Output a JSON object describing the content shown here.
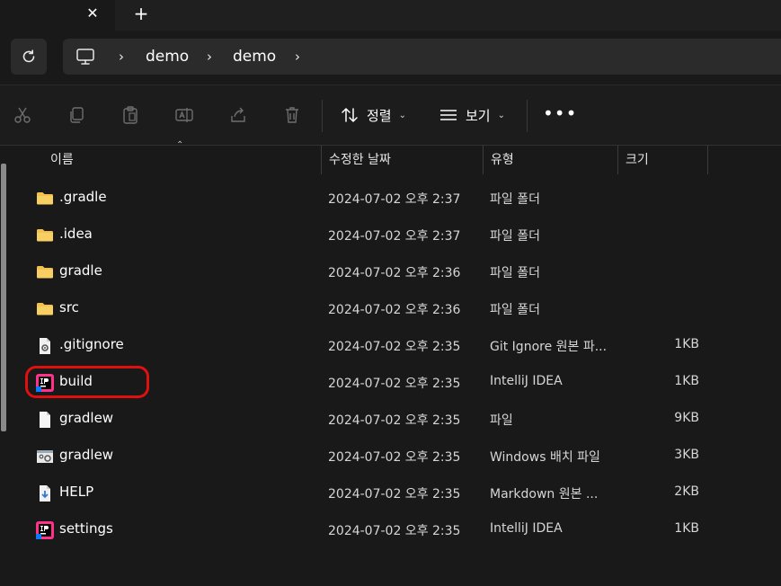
{
  "tabstrip": {
    "close_label": "✕",
    "new_tab_label": "+"
  },
  "address": {
    "crumbs": [
      "demo",
      "demo"
    ],
    "separator": "›"
  },
  "commandbar": {
    "sort_label": "정렬",
    "view_label": "보기",
    "more_label": "•••"
  },
  "columns": {
    "name": "이름",
    "date": "수정한 날짜",
    "type": "유형",
    "size": "크기"
  },
  "files": [
    {
      "name": ".gradle",
      "date": "2024-07-02 오후 2:37",
      "type": "파일 폴더",
      "size": "",
      "icon": "folder-icon"
    },
    {
      "name": ".idea",
      "date": "2024-07-02 오후 2:37",
      "type": "파일 폴더",
      "size": "",
      "icon": "folder-icon"
    },
    {
      "name": "gradle",
      "date": "2024-07-02 오후 2:36",
      "type": "파일 폴더",
      "size": "",
      "icon": "folder-icon"
    },
    {
      "name": "src",
      "date": "2024-07-02 오후 2:36",
      "type": "파일 폴더",
      "size": "",
      "icon": "folder-icon"
    },
    {
      "name": ".gitignore",
      "date": "2024-07-02 오후 2:35",
      "type": "Git Ignore 원본 파...",
      "size": "1KB",
      "icon": "settings-file-icon"
    },
    {
      "name": "build",
      "date": "2024-07-02 오후 2:35",
      "type": "IntelliJ IDEA",
      "size": "1KB",
      "icon": "intellij-icon"
    },
    {
      "name": "gradlew",
      "date": "2024-07-02 오후 2:35",
      "type": "파일",
      "size": "9KB",
      "icon": "file-icon"
    },
    {
      "name": "gradlew",
      "date": "2024-07-02 오후 2:35",
      "type": "Windows 배치 파일",
      "size": "3KB",
      "icon": "batch-file-icon"
    },
    {
      "name": "HELP",
      "date": "2024-07-02 오후 2:35",
      "type": "Markdown 원본 ...",
      "size": "2KB",
      "icon": "markdown-icon"
    },
    {
      "name": "settings",
      "date": "2024-07-02 오후 2:35",
      "type": "IntelliJ IDEA",
      "size": "1KB",
      "icon": "intellij-icon"
    }
  ],
  "colors": {
    "accent_folder": "#f2c14e",
    "annotation": "#e01010"
  }
}
